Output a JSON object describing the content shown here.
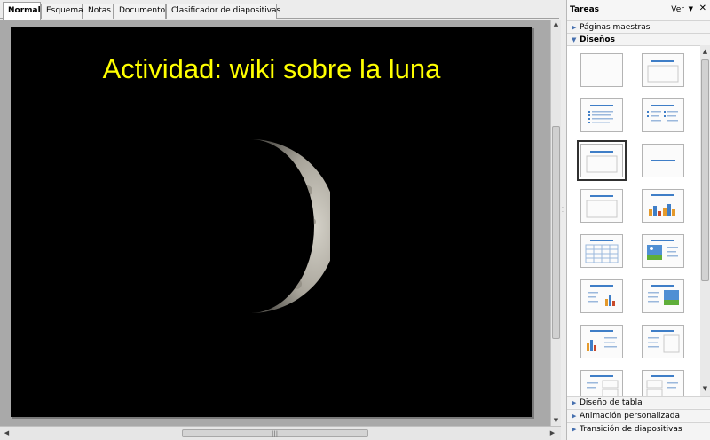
{
  "tabs": [
    {
      "label": "Normal",
      "active": true
    },
    {
      "label": "Esquema",
      "active": false
    },
    {
      "label": "Notas",
      "active": false
    },
    {
      "label": "Documento",
      "active": false
    },
    {
      "label": "Clasificador de diapositivas",
      "active": false
    }
  ],
  "slide": {
    "title": "Actividad: wiki sobre la luna",
    "title_color": "#ffff00",
    "background": "#000000",
    "image": "moon-image"
  },
  "taskpane": {
    "title": "Tareas",
    "view_label": "Ver",
    "sections": {
      "master_pages": "Páginas maestras",
      "layouts": "Diseños",
      "table_design": "Diseño de tabla",
      "custom_animation": "Animación personalizada",
      "slide_transition": "Transición de diapositivas"
    }
  },
  "layouts": [
    {
      "name": "blank"
    },
    {
      "name": "title-only-top"
    },
    {
      "name": "title-content"
    },
    {
      "name": "title-two-columns"
    },
    {
      "name": "title-only",
      "selected": true
    },
    {
      "name": "centered-text"
    },
    {
      "name": "title-object"
    },
    {
      "name": "title-chart"
    },
    {
      "name": "title-table"
    },
    {
      "name": "title-text-clipart"
    },
    {
      "name": "title-text-chart"
    },
    {
      "name": "title-text-clipart-2"
    },
    {
      "name": "title-chart-text"
    },
    {
      "name": "title-text-object"
    },
    {
      "name": "title-text-objects"
    },
    {
      "name": "title-objects-text"
    }
  ]
}
